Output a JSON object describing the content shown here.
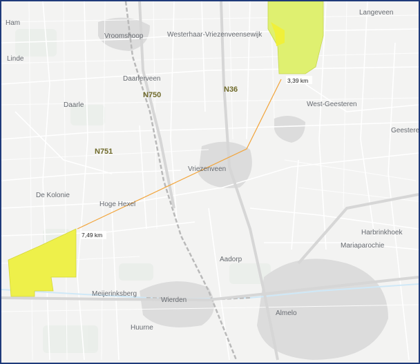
{
  "map": {
    "places": {
      "ham": "Ham",
      "vroomshoop": "Vroomshoop",
      "westerhaar": "Westerhaar-Vriezenveensewijk",
      "langeveen": "Langeveen",
      "linde": "Linde",
      "daarlerveen": "Daarlerveen",
      "daarle": "Daarle",
      "west_geesteren": "West-Geesteren",
      "geesteren": "Geesteren",
      "vriezenveen": "Vriezenveen",
      "de_kolonie": "De Kolonie",
      "hoge_hexel": "Hoge Hexel",
      "harbrinkhoek": "Harbrinkhoek",
      "mariaparochie": "Mariaparochie",
      "aadorp": "Aadorp",
      "meijerinksberg": "Meijerinksberg",
      "wierden": "Wierden",
      "almelo": "Almelo",
      "huurne": "Huurne"
    },
    "roads": {
      "n750": "N750",
      "n36": "N36",
      "n751": "N751"
    },
    "measurements": {
      "north": "3,39 km",
      "southwest": "7,49 km"
    },
    "colors": {
      "area_fill": "#eef04a",
      "area_fill_north": "#dff070",
      "measure_line": "#f2a43a",
      "water_edge": "#cfe8f7"
    }
  }
}
